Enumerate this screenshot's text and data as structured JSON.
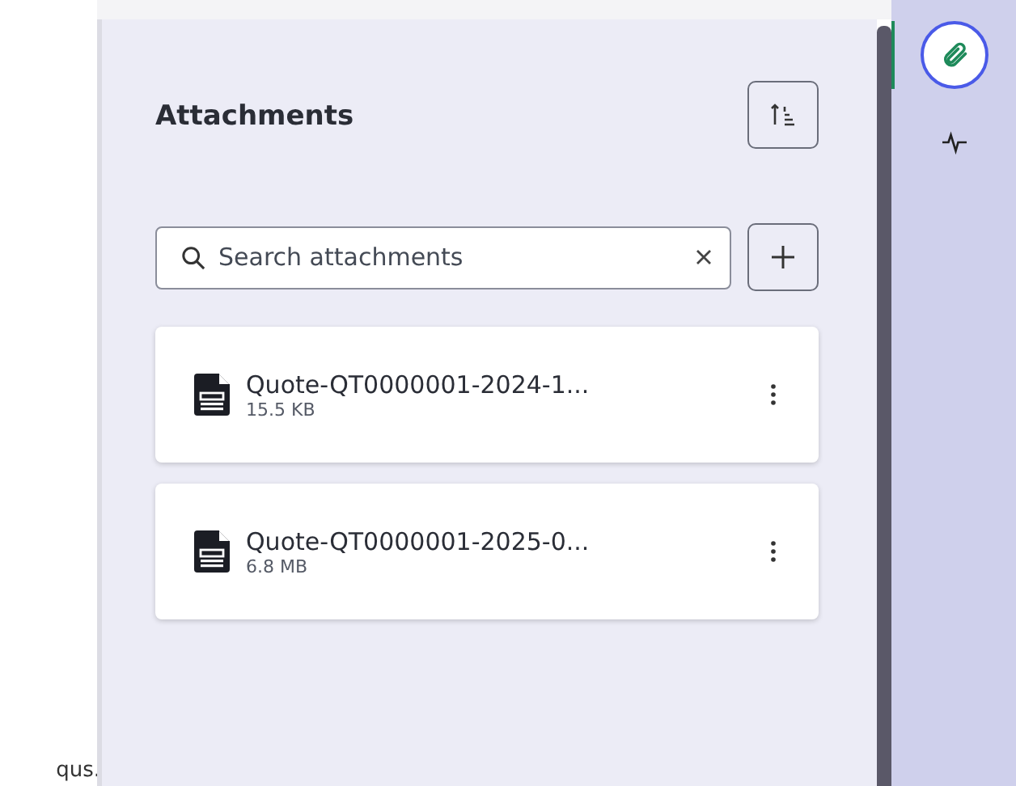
{
  "background_text": "qus.",
  "panel": {
    "title": "Attachments",
    "search": {
      "placeholder": "Search attachments"
    }
  },
  "attachments": [
    {
      "name": "Quote-QT0000001-2024-1...",
      "size": "15.5 KB"
    },
    {
      "name": "Quote-QT0000001-2025-0...",
      "size": "6.8 MB"
    }
  ],
  "rail_tabs": [
    {
      "kind": "paperclip",
      "selected": true
    },
    {
      "kind": "activity",
      "selected": false
    }
  ]
}
